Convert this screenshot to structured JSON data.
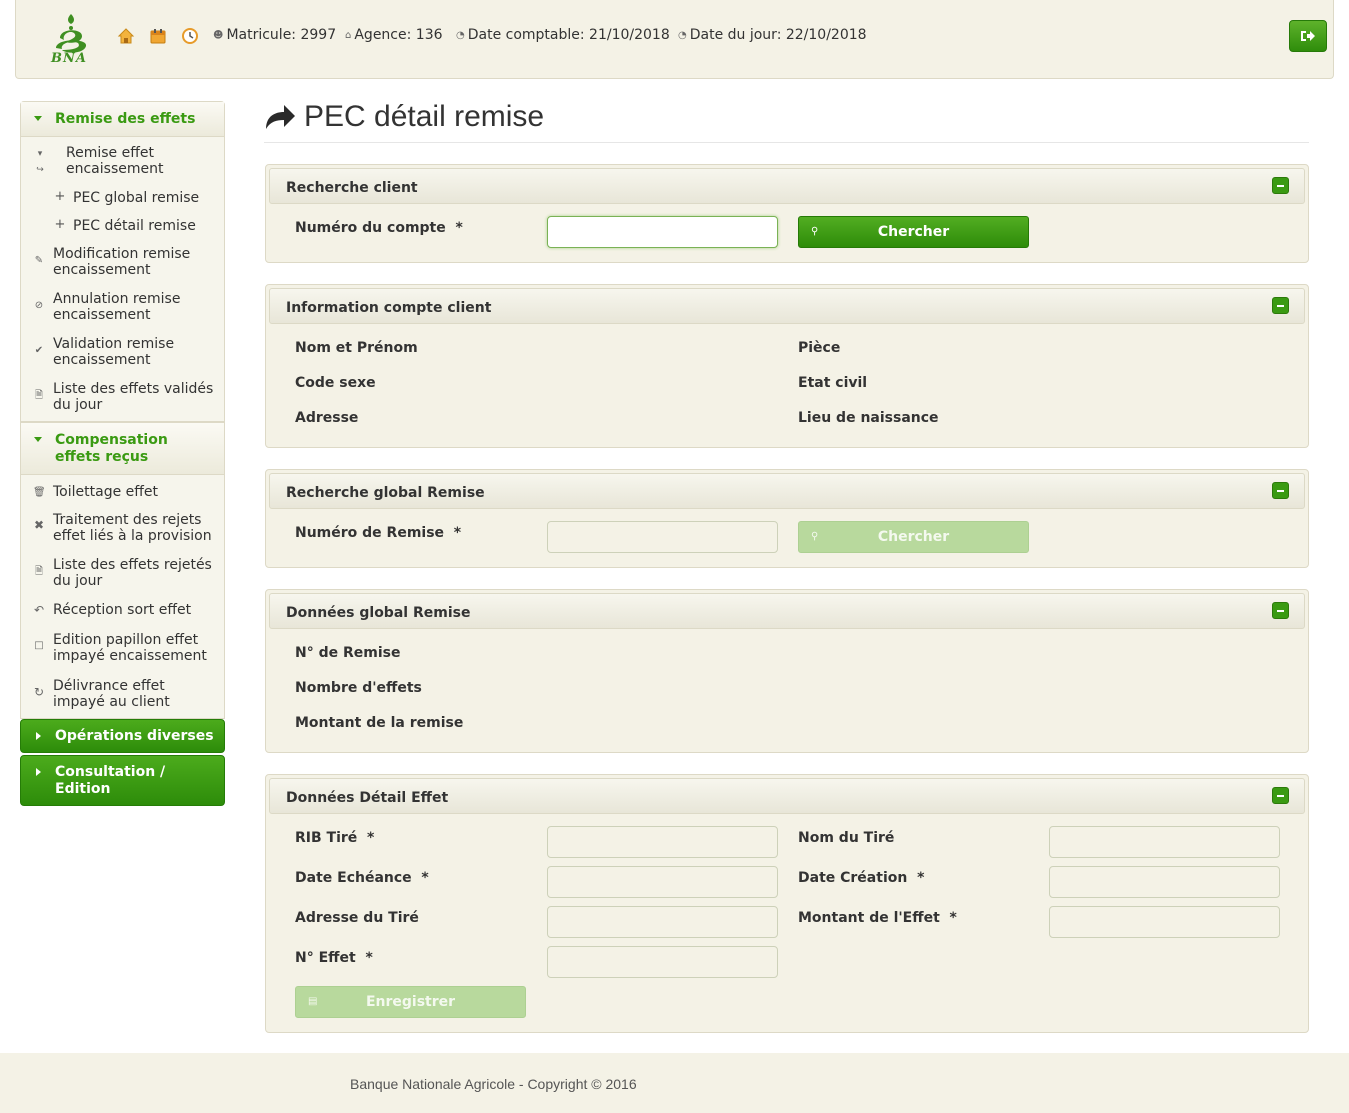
{
  "header": {
    "logo_text": "BNA",
    "matricule": "Matricule: 2997",
    "agence": "Agence: 136",
    "date_comptable": "Date comptable: 21/10/2018",
    "date_jour": "Date du jour: 22/10/2018",
    "icons": [
      "home-icon",
      "calendar-icon",
      "clock-icon",
      "logout-icon"
    ]
  },
  "sidebar": {
    "sections": [
      {
        "title": "Remise des effets",
        "items": [
          {
            "label": "Remise effet encaissement",
            "icon": "return-icon"
          },
          {
            "label": "PEC global remise",
            "icon": "plus-icon"
          },
          {
            "label": "PEC détail remise",
            "icon": "plus-icon"
          },
          {
            "label": "Modification remise encaissement",
            "icon": "pencil-icon"
          },
          {
            "label": "Annulation remise encaissement",
            "icon": "ban-icon"
          },
          {
            "label": "Validation remise encaissement",
            "icon": "check-icon"
          },
          {
            "label": "Liste des effets validés du jour",
            "icon": "file-icon"
          }
        ]
      },
      {
        "title": "Compensation effets reçus",
        "items": [
          {
            "label": "Toilettage effet",
            "icon": "trash-icon"
          },
          {
            "label": "Traitement des rejets effet liés à la provision",
            "icon": "times-icon"
          },
          {
            "label": "Liste des effets rejetés du jour",
            "icon": "file-icon"
          },
          {
            "label": "Réception sort effet",
            "icon": "undo-icon"
          },
          {
            "label": "Edition papillon effet impayé encaissement",
            "icon": "edit-icon"
          },
          {
            "label": "Délivrance effet impayé au client",
            "icon": "refresh-icon"
          }
        ]
      }
    ],
    "collapsed": [
      "Opérations diverses",
      "Consultation / Edition"
    ]
  },
  "main": {
    "title": "PEC détail remise",
    "recherche_client": {
      "title": "Recherche client",
      "label": "Numéro du compte",
      "required": "*",
      "value": "",
      "button": "Chercher"
    },
    "info_client": {
      "title": "Information compte client",
      "left": [
        "Nom et Prénom",
        "Code sexe",
        "Adresse"
      ],
      "right": [
        "Pièce",
        "Etat civil",
        "Lieu de naissance"
      ]
    },
    "recherche_global": {
      "title": "Recherche global Remise",
      "label": "Numéro de Remise",
      "required": "*",
      "value": "",
      "button": "Chercher"
    },
    "donnees_global": {
      "title": "Données global Remise",
      "fields": [
        "N° de Remise",
        "Nombre d'effets",
        "Montant de la remise"
      ]
    },
    "detail_effet": {
      "title": "Données Détail Effet",
      "rib_tire": "RIB Tiré",
      "date_echeance": "Date Echéance",
      "adresse_tire": "Adresse du Tiré",
      "num_effet": "N° Effet",
      "nom_tire": "Nom du Tiré",
      "date_creation": "Date Création",
      "montant_effet": "Montant de l'Effet",
      "required": "*",
      "button": "Enregistrer"
    }
  },
  "footer": {
    "text": "Banque Nationale Agricole - Copyright © 2016"
  },
  "colors": {
    "accent": "#3a9a12",
    "panel_bg": "#f4f2e6"
  }
}
